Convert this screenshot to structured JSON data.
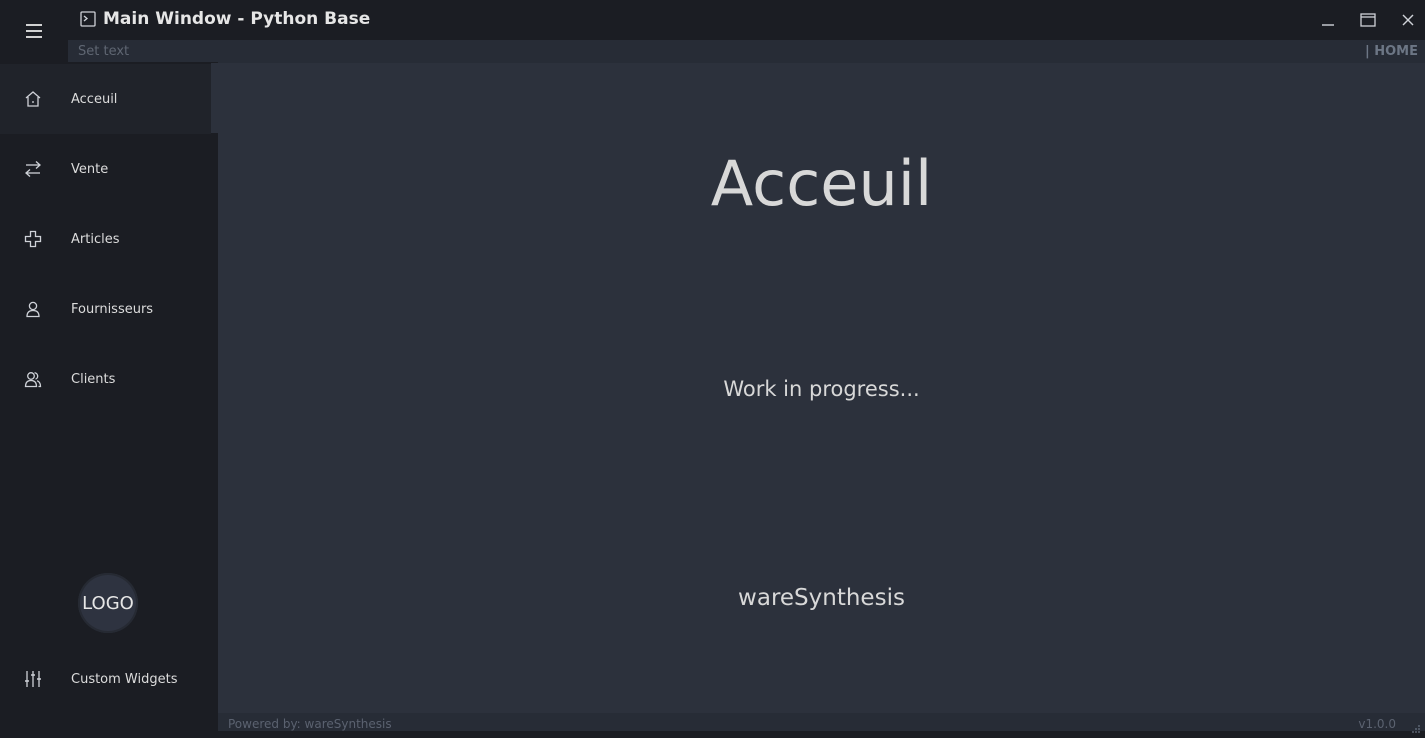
{
  "window": {
    "title": "Main Window - Python Base",
    "subtitle_placeholder": "Set text",
    "current_page_label": "| HOME"
  },
  "controls": {
    "menu_icon": "hamburger-icon",
    "app_icon": "terminal-icon",
    "minimize_icon": "minimize-icon",
    "maximize_icon": "maximize-icon",
    "close_icon": "close-icon"
  },
  "sidebar": {
    "items": [
      {
        "label": "Acceuil",
        "icon": "home-icon",
        "active": true
      },
      {
        "label": "Vente",
        "icon": "transfer-arrows-icon"
      },
      {
        "label": "Articles",
        "icon": "plus-outline-icon"
      },
      {
        "label": "Fournisseurs",
        "icon": "user-icon"
      },
      {
        "label": "Clients",
        "icon": "users-icon"
      }
    ],
    "logo_text": "LOGO",
    "bottom_item": {
      "label": "Custom Widgets",
      "icon": "sliders-icon"
    }
  },
  "main": {
    "heading": "Acceuil",
    "message": "Work in progress...",
    "brand": "wareSynthesis"
  },
  "footer": {
    "powered_by": "Powered by: wareSynthesis",
    "version": "v1.0.0"
  },
  "colors": {
    "sidebar_bg": "#1b1d23",
    "content_bg": "#2c313c",
    "bar_bg": "#272c36",
    "text": "#dddddd"
  }
}
